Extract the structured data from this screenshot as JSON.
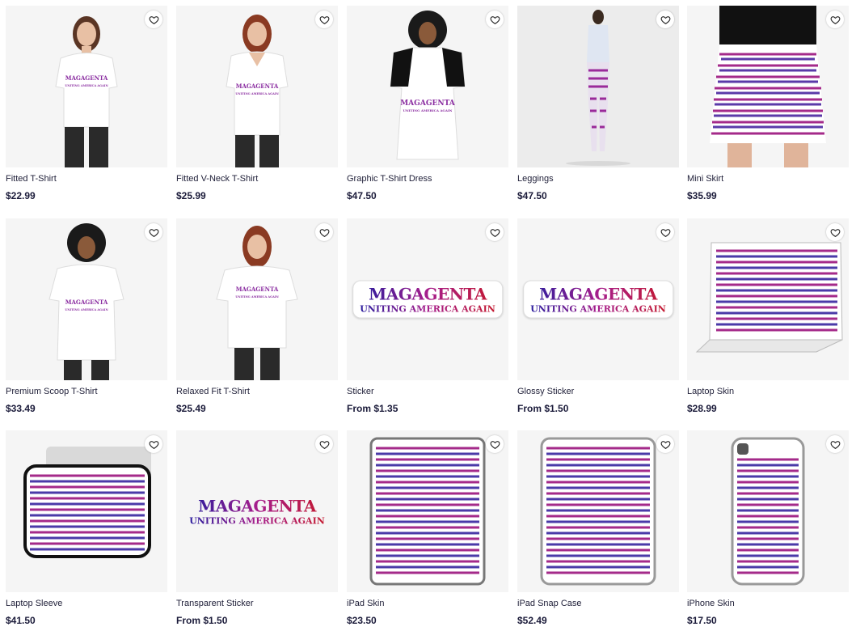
{
  "products": [
    {
      "name": "Fitted T-Shirt",
      "price": "$22.99",
      "kind": "tee"
    },
    {
      "name": "Fitted V-Neck T-Shirt",
      "price": "$25.99",
      "kind": "tee"
    },
    {
      "name": "Graphic T-Shirt Dress",
      "price": "$47.50",
      "kind": "dress"
    },
    {
      "name": "Leggings",
      "price": "$47.50",
      "kind": "leggings"
    },
    {
      "name": "Mini Skirt",
      "price": "$35.99",
      "kind": "skirt"
    },
    {
      "name": "Premium Scoop T-Shirt",
      "price": "$33.49",
      "kind": "tee"
    },
    {
      "name": "Relaxed Fit T-Shirt",
      "price": "$25.49",
      "kind": "tee"
    },
    {
      "name": "Sticker",
      "price": "From $1.35",
      "kind": "sticker"
    },
    {
      "name": "Glossy Sticker",
      "price": "From $1.50",
      "kind": "sticker"
    },
    {
      "name": "Laptop Skin",
      "price": "$28.99",
      "kind": "laptop"
    },
    {
      "name": "Laptop Sleeve",
      "price": "$41.50",
      "kind": "sleeve"
    },
    {
      "name": "Transparent Sticker",
      "price": "From $1.50",
      "kind": "sticker"
    },
    {
      "name": "iPad Skin",
      "price": "$23.50",
      "kind": "ipad"
    },
    {
      "name": "iPad Snap Case",
      "price": "$52.49",
      "kind": "ipad"
    },
    {
      "name": "iPhone Skin",
      "price": "$17.50",
      "kind": "iphone"
    }
  ],
  "design": {
    "title": "MAGAGENTA",
    "tagline": "UNITING AMERICA AGAIN"
  },
  "colors": {
    "logo_blue": "#2a1d9e",
    "logo_magenta": "#a61e8c",
    "logo_red": "#c4192f",
    "card_bg": "#f5f5f5"
  },
  "icons": {
    "favorite": "heart-outline-icon"
  }
}
